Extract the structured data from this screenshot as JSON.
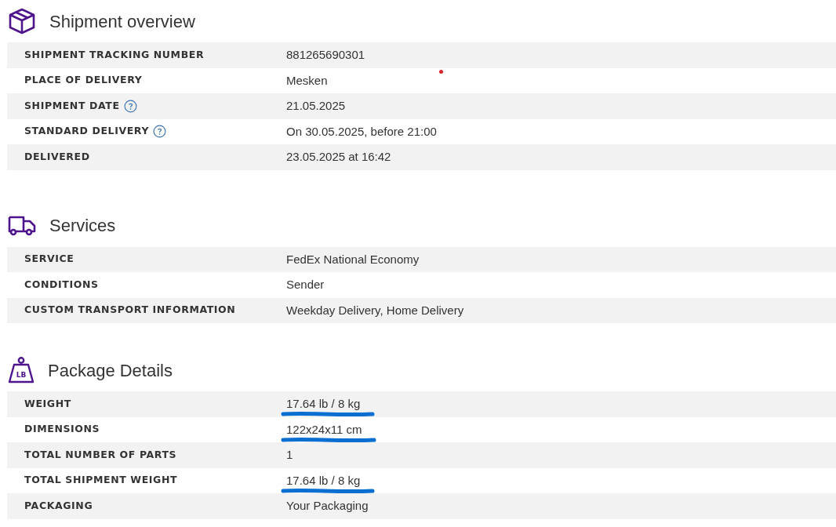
{
  "sections": [
    {
      "title": "Shipment overview",
      "rows": [
        {
          "label": "SHIPMENT TRACKING NUMBER",
          "value": "881265690301",
          "help": false,
          "underlined": false
        },
        {
          "label": "PLACE OF DELIVERY",
          "value": "Mesken",
          "help": false,
          "underlined": false
        },
        {
          "label": "SHIPMENT DATE",
          "value": "21.05.2025",
          "help": true,
          "underlined": false
        },
        {
          "label": "STANDARD DELIVERY",
          "value": "On 30.05.2025, before 21:00",
          "help": true,
          "underlined": false
        },
        {
          "label": "DELIVERED",
          "value": "23.05.2025 at 16:42",
          "help": false,
          "underlined": false
        }
      ]
    },
    {
      "title": "Services",
      "rows": [
        {
          "label": "SERVICE",
          "value": "FedEx National Economy",
          "help": false,
          "underlined": false
        },
        {
          "label": "CONDITIONS",
          "value": "Sender",
          "help": false,
          "underlined": false
        },
        {
          "label": "CUSTOM TRANSPORT INFORMATION",
          "value": "Weekday Delivery, Home Delivery",
          "help": false,
          "underlined": false
        }
      ]
    },
    {
      "title": "Package Details",
      "icon_text": "LB",
      "rows": [
        {
          "label": "WEIGHT",
          "value": "17.64 lb / 8 kg",
          "help": false,
          "underlined": true
        },
        {
          "label": "DIMENSIONS",
          "value": "122x24x11 cm",
          "help": false,
          "underlined": true
        },
        {
          "label": "TOTAL NUMBER OF PARTS",
          "value": "1",
          "help": false,
          "underlined": false
        },
        {
          "label": "TOTAL SHIPMENT WEIGHT",
          "value": "17.64 lb / 8 kg",
          "help": false,
          "underlined": true
        },
        {
          "label": "PACKAGING",
          "value": "Your Packaging",
          "help": false,
          "underlined": false
        }
      ]
    }
  ]
}
